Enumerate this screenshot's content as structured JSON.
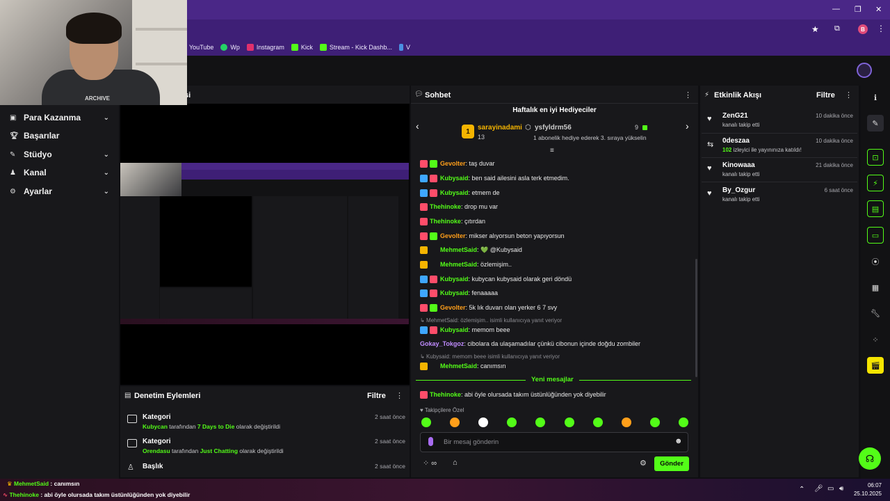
{
  "browser": {
    "profile_initial": "B",
    "bookmarks": [
      {
        "label": "YouTube",
        "color": "#ff0000"
      },
      {
        "label": "Wp",
        "color": "#25d366"
      },
      {
        "label": "Instagram",
        "color": "#e1306c"
      },
      {
        "label": "Kick",
        "color": "#53fc18"
      },
      {
        "label": "Stream - Kick Dashb...",
        "color": "#53fc18"
      },
      {
        "label": "V",
        "color": "#4a90e2"
      }
    ]
  },
  "webcam": {
    "shirt_text": "ARCHIVE"
  },
  "sidebar": {
    "items": [
      {
        "label": "Para Kazanma",
        "icon": "money-icon",
        "has_chevron": true
      },
      {
        "label": "Başarılar",
        "icon": "trophy-icon",
        "has_chevron": false
      },
      {
        "label": "Stüdyo",
        "icon": "studio-icon",
        "has_chevron": true
      },
      {
        "label": "Kanal",
        "icon": "channel-icon",
        "has_chevron": true
      },
      {
        "label": "Ayarlar",
        "icon": "settings-icon",
        "has_chevron": true
      }
    ]
  },
  "stream": {
    "title_fragment": "si"
  },
  "moderation": {
    "title": "Denetim Eylemleri",
    "filter": "Filtre",
    "items": [
      {
        "title": "Kategori",
        "user": "Kubycan",
        "mid": " tarafından ",
        "value": "7 Days to Die",
        "tail": " olarak değiştirildi",
        "time": "2 saat önce"
      },
      {
        "title": "Kategori",
        "user": "Orendasu",
        "mid": " tarafından ",
        "value": "Just Chatting",
        "tail": " olarak değiştirildi",
        "time": "2 saat önce"
      },
      {
        "title": "Başlık",
        "user": "",
        "mid": "",
        "value": "",
        "tail": "",
        "time": "2 saat önce"
      }
    ]
  },
  "chat": {
    "title": "Sohbet",
    "top_gifters_title": "Haftalık en iyi Hediyeciler",
    "gifter1": {
      "rank": "1",
      "name": "sarayinadami",
      "count": "13"
    },
    "gifter2": {
      "name": "ysfyldrm56",
      "count": "9",
      "note": "1 abonelik hediye ederek 3. sıraya yükselin"
    },
    "messages": [
      {
        "user": "Gevolter",
        "color": "#ff9f1a",
        "text": ": taş duvar",
        "badges": [
          "#ff4d6a",
          "#53fc18"
        ]
      },
      {
        "user": "Kubysaid",
        "color": "#53fc18",
        "text": ": ben said ailesini asla terk etmedim.",
        "badges": [
          "#3ea7ff",
          "#ff4d6a"
        ]
      },
      {
        "user": "Kubysaid",
        "color": "#53fc18",
        "text": ": etmem de",
        "badges": [
          "#3ea7ff",
          "#ff4d6a"
        ]
      },
      {
        "user": "Thehinoke",
        "color": "#53fc18",
        "text": ": drop mu var",
        "badges": [
          "#ff4d6a"
        ]
      },
      {
        "user": "Thehinoke",
        "color": "#53fc18",
        "text": ": çıtırdan",
        "badges": [
          "#ff4d6a"
        ]
      },
      {
        "user": "Gevolter",
        "color": "#ff9f1a",
        "text": ": mikser alıyorsun beton yapıyorsun",
        "badges": [
          "#ff4d6a",
          "#53fc18"
        ]
      },
      {
        "user": "MehmetSaid",
        "color": "#53fc18",
        "text": ": 💚 @Kubysaid",
        "badges": [
          "#f5b400",
          "#18181b"
        ]
      },
      {
        "user": "MehmetSaid",
        "color": "#53fc18",
        "text": ": özlemişim..",
        "badges": [
          "#f5b400",
          "#18181b"
        ]
      },
      {
        "user": "Kubysaid",
        "color": "#53fc18",
        "text": ": kubycan kubysaid olarak geri döndü",
        "badges": [
          "#3ea7ff",
          "#ff4d6a"
        ]
      },
      {
        "user": "Kubysaid",
        "color": "#53fc18",
        "text": ": fenaaaaa",
        "badges": [
          "#3ea7ff",
          "#ff4d6a"
        ]
      },
      {
        "user": "Gevolter",
        "color": "#ff9f1a",
        "text": ": 5k lık duvarı olan yerker 6 7 svy",
        "badges": [
          "#ff4d6a",
          "#53fc18"
        ]
      }
    ],
    "reply1": "MehmetSaid: özlemişim.. isimli kullanıcıya yanıt veriyor",
    "msg_after_reply1": {
      "user": "Kubysaid",
      "color": "#53fc18",
      "text": ": memom beee"
    },
    "msg_gokay": {
      "user": "Gokay_Tokgoz",
      "color": "#c08cff",
      "text": ": cibolara da ulaşamadılar çünkü cibonun içinde doğdu zombiler"
    },
    "reply2": "Kubysaid: memom beee isimli kullanıcıya yanıt veriyor",
    "msg_after_reply2": {
      "user": "MehmetSaid",
      "color": "#53fc18",
      "text": ": canımsın"
    },
    "new_messages": "Yeni mesajlar",
    "msg_new": {
      "user": "Thehinoke",
      "color": "#53fc18",
      "text": ": abi öyle olursada takım üstünlüğünden yok diyebilir"
    },
    "followers_only": "Takipçilere Özel",
    "input_placeholder": "Bir mesaj gönderin",
    "send": "Gönder"
  },
  "events": {
    "title": "Etkinlik Akışı",
    "filter": "Filtre",
    "items": [
      {
        "name": "ZenG21",
        "desc": "kanalı takip etti",
        "time": "10 dakika önce",
        "highlight": ""
      },
      {
        "name": "0deszaa",
        "desc": " izleyici ile yayınınıza katıldı!",
        "time": "10 dakika önce",
        "highlight": "102"
      },
      {
        "name": "Kinowaaa",
        "desc": "kanalı takip etti",
        "time": "21 dakika önce",
        "highlight": ""
      },
      {
        "name": "By_Ozgur",
        "desc": "kanalı takip etti",
        "time": "6 saat önce",
        "highlight": ""
      }
    ]
  },
  "taskbar": {
    "time": "06:07",
    "date": "25.10.2025",
    "overlay_line1_user": "MehmetSaid",
    "overlay_line1_text": " : canımsın",
    "overlay_line2_user": "Thehinoke",
    "overlay_line2_text": " : abi öyle olursada takım üstünlüğünden yok diyebilir"
  }
}
